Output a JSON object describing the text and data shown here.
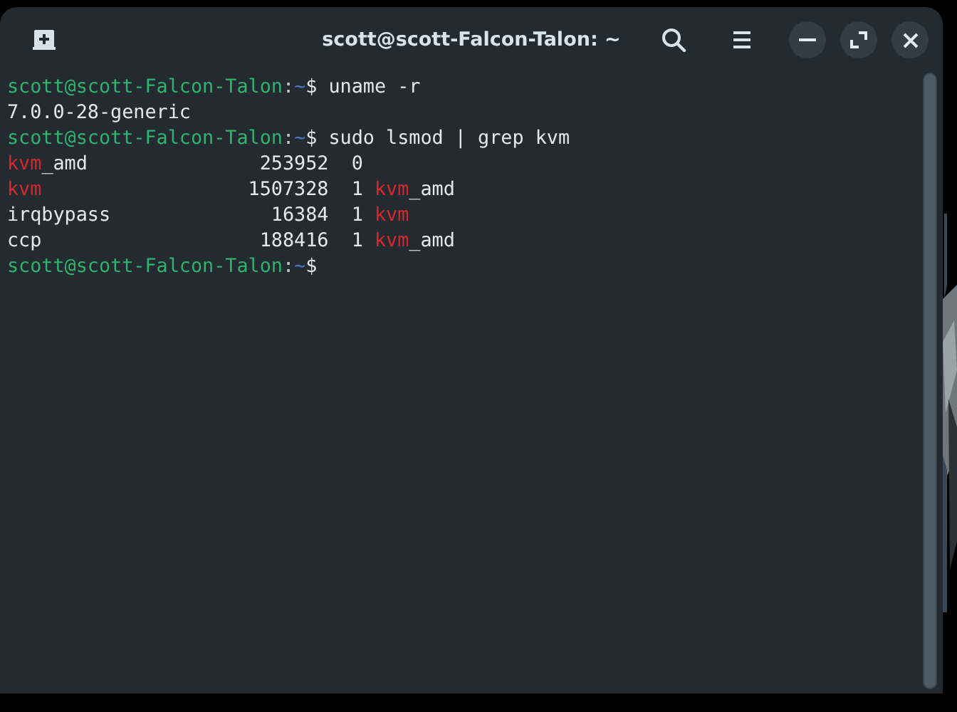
{
  "window": {
    "title": "scott@scott-Falcon-Talon: ~"
  },
  "terminal": {
    "lines": [
      {
        "segments": [
          {
            "kind": "user",
            "text": "scott@scott-Falcon-Talon"
          },
          {
            "kind": "sep",
            "text": ":"
          },
          {
            "kind": "path",
            "text": "~"
          },
          {
            "kind": "plain",
            "text": "$ uname -r"
          }
        ]
      },
      {
        "segments": [
          {
            "kind": "plain",
            "text": "7.0.0-28-generic"
          }
        ]
      },
      {
        "segments": [
          {
            "kind": "user",
            "text": "scott@scott-Falcon-Talon"
          },
          {
            "kind": "sep",
            "text": ":"
          },
          {
            "kind": "path",
            "text": "~"
          },
          {
            "kind": "plain",
            "text": "$ sudo lsmod | grep kvm"
          }
        ]
      },
      {
        "segments": [
          {
            "kind": "match",
            "text": "kvm"
          },
          {
            "kind": "plain",
            "text": "_amd               253952  0"
          }
        ]
      },
      {
        "segments": [
          {
            "kind": "match",
            "text": "kvm"
          },
          {
            "kind": "plain",
            "text": "                  1507328  1 "
          },
          {
            "kind": "match",
            "text": "kvm"
          },
          {
            "kind": "plain",
            "text": "_amd"
          }
        ]
      },
      {
        "segments": [
          {
            "kind": "plain",
            "text": "irqbypass              16384  1 "
          },
          {
            "kind": "match",
            "text": "kvm"
          }
        ]
      },
      {
        "segments": [
          {
            "kind": "plain",
            "text": "ccp                   188416  1 "
          },
          {
            "kind": "match",
            "text": "kvm"
          },
          {
            "kind": "plain",
            "text": "_amd"
          }
        ]
      },
      {
        "segments": [
          {
            "kind": "user",
            "text": "scott@scott-Falcon-Talon"
          },
          {
            "kind": "sep",
            "text": ":"
          },
          {
            "kind": "path",
            "text": "~"
          },
          {
            "kind": "plain",
            "text": "$"
          }
        ]
      }
    ]
  }
}
